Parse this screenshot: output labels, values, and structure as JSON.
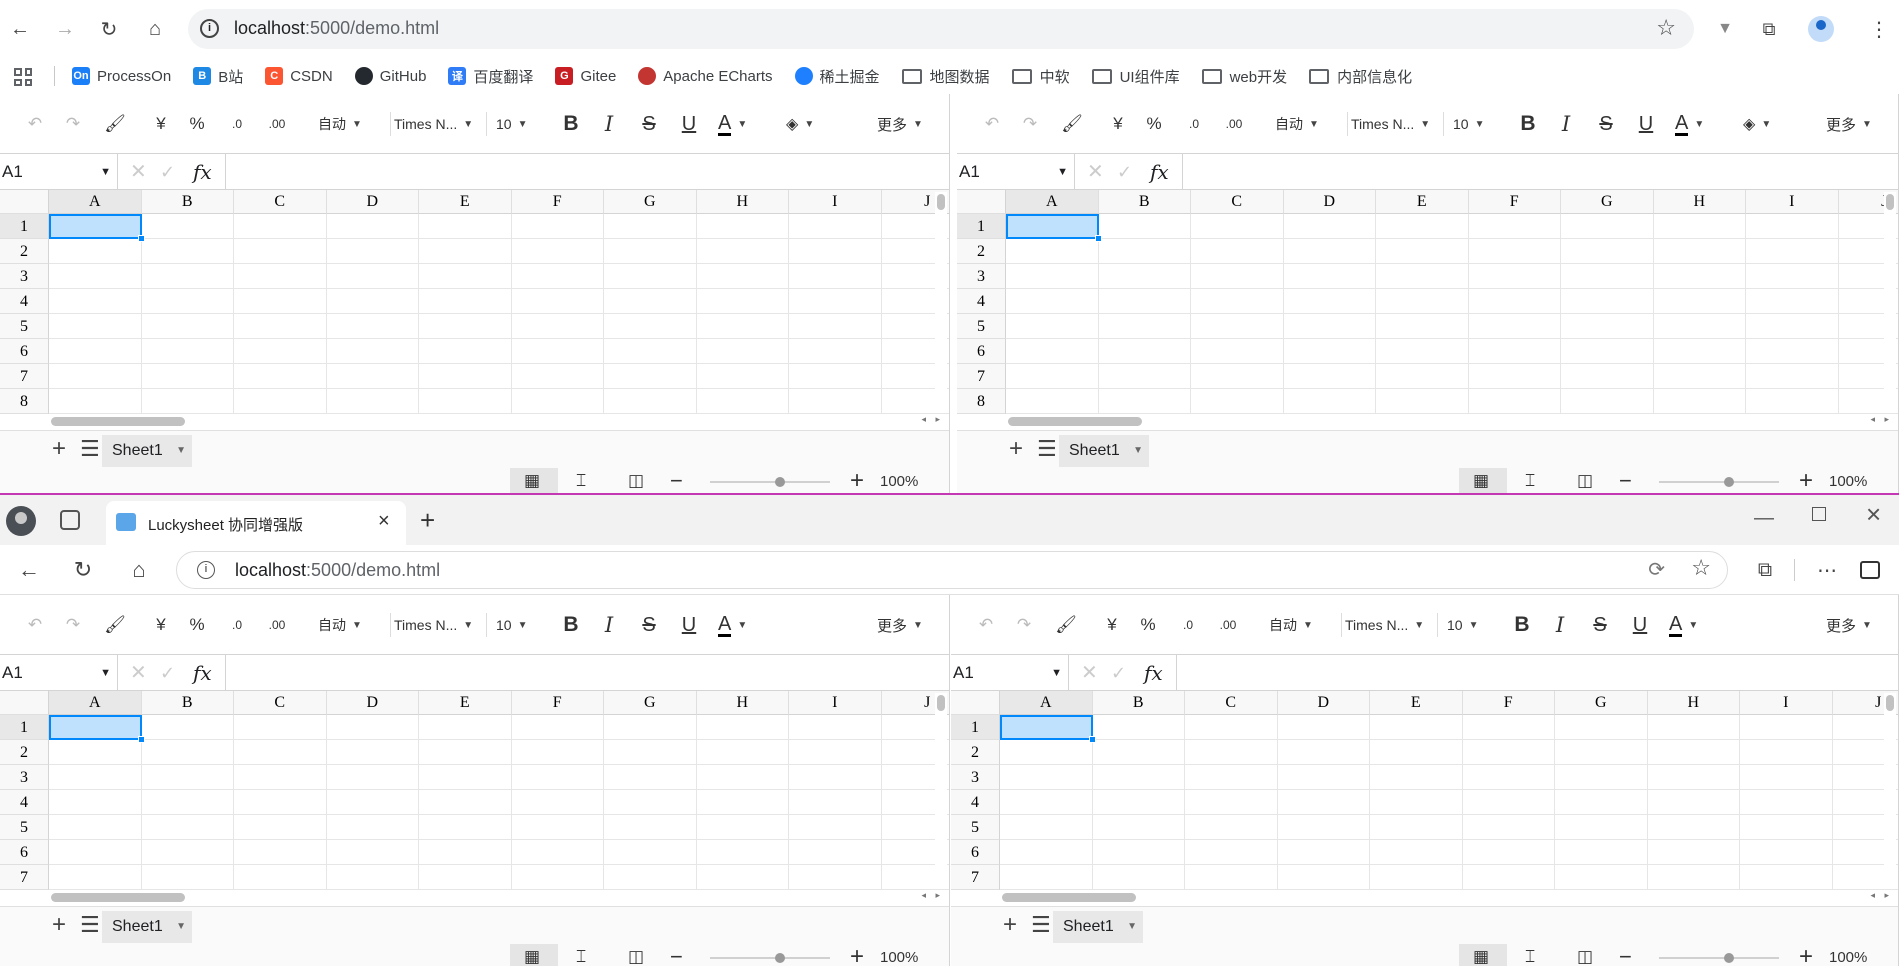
{
  "chrome": {
    "url_host": "localhost",
    "url_rest": ":5000/demo.html",
    "bookmarks": [
      {
        "label": "ProcessOn",
        "icon": "On",
        "color": "#1b7ff7"
      },
      {
        "label": "B站",
        "icon": "B",
        "color": "#1e88e5"
      },
      {
        "label": "CSDN",
        "icon": "C",
        "color": "#fc5531"
      },
      {
        "label": "GitHub",
        "icon": "github-icon",
        "color": "#24292f"
      },
      {
        "label": "百度翻译",
        "icon": "译",
        "color": "#2f7cf6"
      },
      {
        "label": "Gitee",
        "icon": "G",
        "color": "#c71d23"
      },
      {
        "label": "Apache ECharts",
        "icon": "echarts-icon",
        "color": "#c23531"
      },
      {
        "label": "稀土掘金",
        "icon": "juejin-icon",
        "color": "#1e80ff"
      },
      {
        "label": "地图数据",
        "icon": "folder-icon",
        "color": "#5f6368"
      },
      {
        "label": "中软",
        "icon": "folder-icon",
        "color": "#5f6368"
      },
      {
        "label": "UI组件库",
        "icon": "folder-icon",
        "color": "#5f6368"
      },
      {
        "label": "web开发",
        "icon": "folder-icon",
        "color": "#5f6368"
      },
      {
        "label": "内部信息化",
        "icon": "folder-icon",
        "color": "#5f6368"
      }
    ]
  },
  "edge": {
    "tab_title": "Luckysheet 协同增强版",
    "url_host": "localhost",
    "url_rest": ":5000/demo.html"
  },
  "sheet": {
    "toolbar": {
      "currency": "¥",
      "percent": "%",
      "dec_decrease": ".0",
      "dec_increase": ".00",
      "format_auto": "自动",
      "font": "Times N...",
      "font_size": "10",
      "bold": "B",
      "italic": "I",
      "strike": "S",
      "underline": "U",
      "font_color": "A",
      "more": "更多"
    },
    "cell_ref": "A1",
    "fx": "fx",
    "columns": [
      "A",
      "B",
      "C",
      "D",
      "E",
      "F",
      "G",
      "H",
      "I",
      "J"
    ],
    "rows": [
      "1",
      "2",
      "3",
      "4",
      "5",
      "6",
      "7",
      "8"
    ],
    "sheet_tab": "Sheet1",
    "zoom": "100%",
    "zoom_level": 0.5
  },
  "colors": {
    "selection": "#0188fb",
    "edge_accent": "#c239b3"
  }
}
